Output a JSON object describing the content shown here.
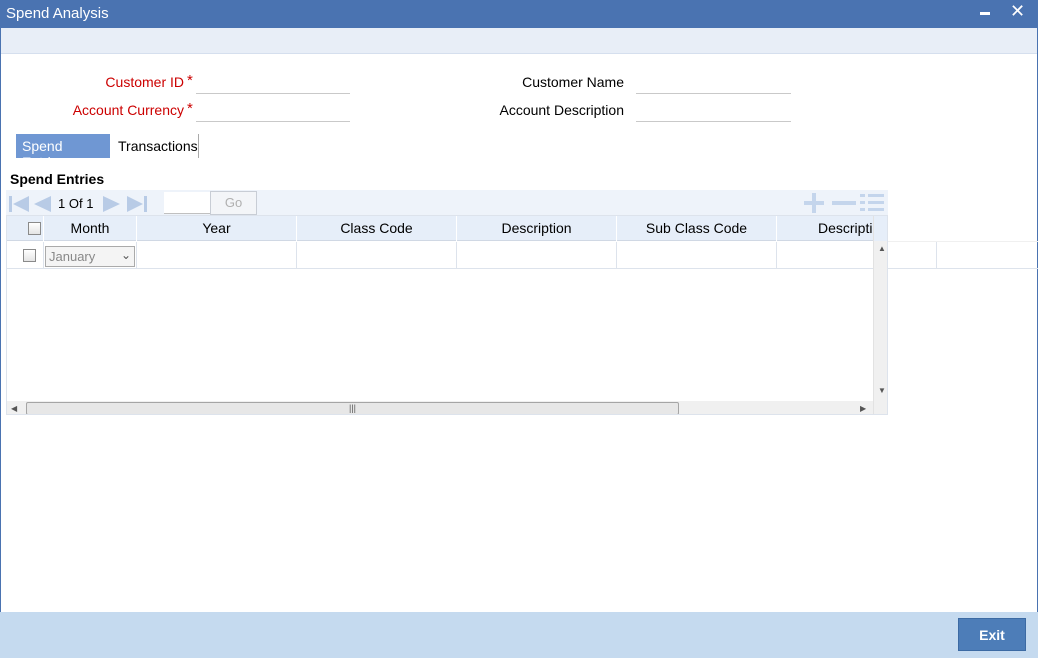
{
  "window": {
    "title": "Spend Analysis"
  },
  "form": {
    "customer_id_label": "Customer ID",
    "account_currency_label": "Account Currency",
    "customer_name_label": "Customer Name",
    "account_description_label": "Account Description",
    "required_mark": "*",
    "customer_id_value": "",
    "account_currency_value": "",
    "customer_name_value": "",
    "account_description_value": ""
  },
  "tabs": [
    {
      "label": "Spend Entries",
      "active": true
    },
    {
      "label": "Transactions",
      "active": false
    }
  ],
  "section": {
    "title": "Spend Entries"
  },
  "toolbar": {
    "page_current": "1",
    "page_of": "Of",
    "page_total": "1",
    "page_input": "",
    "go_label": "Go"
  },
  "table": {
    "columns": [
      "Month",
      "Year",
      "Class Code",
      "Description",
      "Sub Class Code",
      "Descriptio"
    ],
    "rows": [
      {
        "month": "January",
        "year": "",
        "class_code": "",
        "description": "",
        "sub_class_code": "",
        "sub_description": ""
      }
    ]
  },
  "footer": {
    "exit_label": "Exit"
  },
  "colors": {
    "titlebar": "#4a73b1",
    "active_tab": "#6f97d3",
    "footer": "#c5daef",
    "exit_button": "#4d7db8",
    "required": "#cc0000"
  }
}
